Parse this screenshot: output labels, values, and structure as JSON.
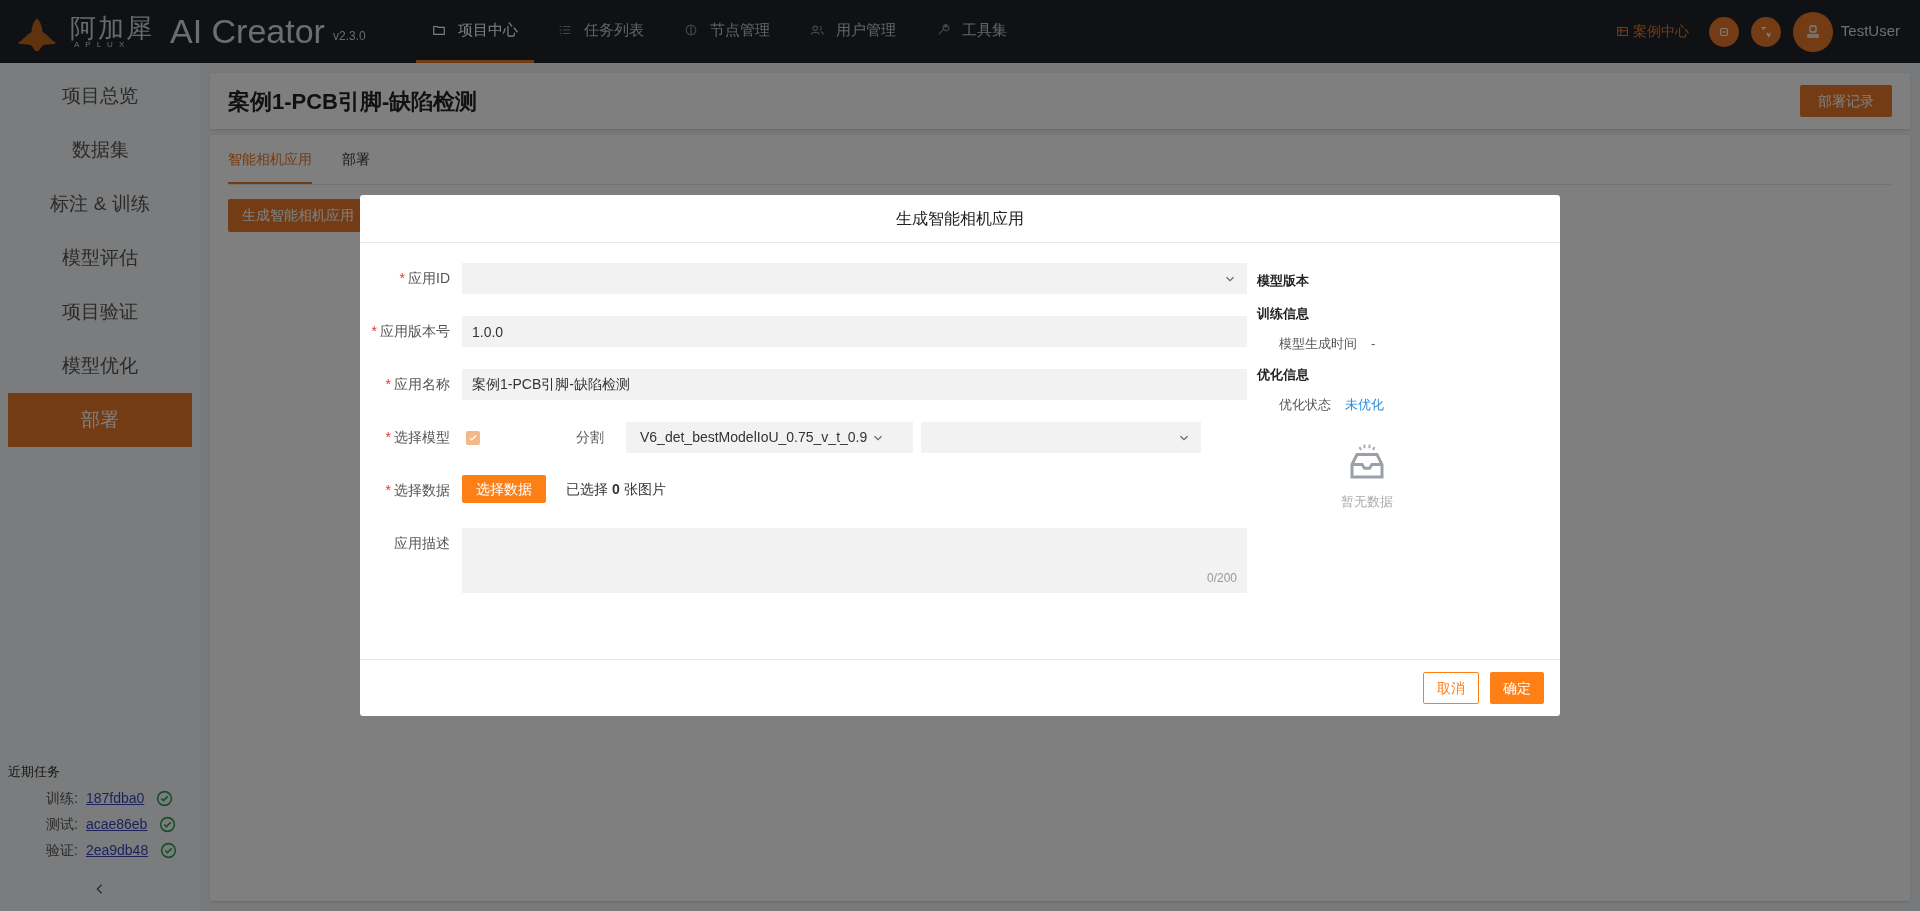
{
  "header": {
    "logo_text": "阿加犀",
    "logo_sub": "APLUX",
    "app_name": "AI Creator",
    "version": "v2.3.0",
    "nav": [
      {
        "label": "项目中心",
        "selected": true
      },
      {
        "label": "任务列表",
        "selected": false
      },
      {
        "label": "节点管理",
        "selected": false
      },
      {
        "label": "用户管理",
        "selected": false
      },
      {
        "label": "工具集",
        "selected": false
      }
    ],
    "case_center": "案例中心",
    "user": "TestUser"
  },
  "sidebar": {
    "items": [
      {
        "label": "项目总览",
        "selected": false
      },
      {
        "label": "数据集",
        "selected": false
      },
      {
        "label": "标注 & 训练",
        "selected": false
      },
      {
        "label": "模型评估",
        "selected": false
      },
      {
        "label": "项目验证",
        "selected": false
      },
      {
        "label": "模型优化",
        "selected": false
      },
      {
        "label": "部署",
        "selected": true
      }
    ],
    "recent_title": "近期任务",
    "recent_tasks": [
      {
        "label": "训练:",
        "id": "187fdba0",
        "done": true
      },
      {
        "label": "测试:",
        "id": "acae86eb",
        "done": true
      },
      {
        "label": "验证:",
        "id": "2ea9db48",
        "done": true
      }
    ]
  },
  "page": {
    "title": "案例1-PCB引脚-缺陷检测",
    "deploy_record_button": "部署记录",
    "tabs": [
      {
        "label": "智能相机应用",
        "selected": true
      },
      {
        "label": "部署",
        "selected": false
      }
    ],
    "generate_button": "生成智能相机应用"
  },
  "dialog": {
    "title": "生成智能相机应用",
    "fields": [
      {
        "kind": "select",
        "label": "应用ID",
        "required_mark": "*"
      },
      {
        "kind": "text",
        "label": "应用版本号",
        "required_mark": "*",
        "value": "1.0.0"
      },
      {
        "kind": "text",
        "label": "应用名称",
        "required_mark": "*",
        "value": "案例1-PCB引脚-缺陷检测"
      },
      {
        "kind": "model",
        "label": "选择模型",
        "required_mark": "*",
        "checked": true,
        "segment_label": "分割",
        "model_value": "V6_det_bestModelIoU_0.75_v_t_0.9"
      },
      {
        "kind": "data",
        "label": "选择数据",
        "required_mark": "*",
        "button": "选择数据",
        "selected_text": "已选择 **0** 张图片"
      },
      {
        "kind": "textarea",
        "label": "应用描述",
        "counter": "0/200"
      }
    ],
    "info": {
      "model_version_title": "模型版本",
      "training_title": "训练信息",
      "training_rows": [
        {
          "label": "模型生成时间",
          "value": "-"
        }
      ],
      "optimization_title": "优化信息",
      "optimization_rows": [
        {
          "label": "优化状态",
          "value": "未优化"
        }
      ],
      "empty_text": "暂无数据"
    },
    "buttons": [
      {
        "label": "取消",
        "kind": "secondary"
      },
      {
        "label": "确定",
        "kind": "primary"
      }
    ]
  }
}
